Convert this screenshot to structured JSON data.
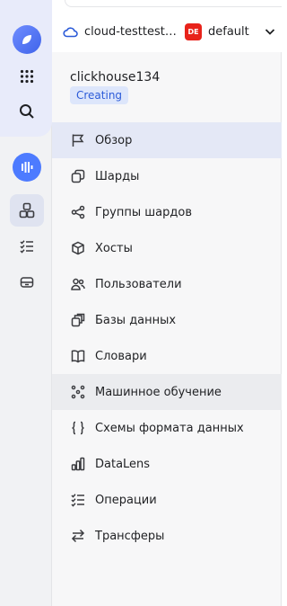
{
  "rail": {
    "logo_icon": "cloud-logo-icon",
    "items": [
      {
        "icon": "apps-grid-icon"
      },
      {
        "icon": "search-icon"
      },
      {
        "icon": "clickhouse-service-icon"
      },
      {
        "icon": "clusters-icon",
        "active": true
      },
      {
        "icon": "list-icon"
      },
      {
        "icon": "storage-icon"
      }
    ]
  },
  "header": {
    "folder": "cloud-testtestte…",
    "env_badge": "DE",
    "env_name": "default"
  },
  "cluster": {
    "name": "clickhouse134",
    "status": "Creating"
  },
  "menu": [
    {
      "label": "Обзор",
      "icon": "flag-icon",
      "state": "active"
    },
    {
      "label": "Шарды",
      "icon": "shards-icon"
    },
    {
      "label": "Группы шардов",
      "icon": "share-nodes-icon"
    },
    {
      "label": "Хосты",
      "icon": "cube-icon"
    },
    {
      "label": "Пользователи",
      "icon": "users-icon"
    },
    {
      "label": "Базы данных",
      "icon": "databases-icon"
    },
    {
      "label": "Словари",
      "icon": "book-icon"
    },
    {
      "label": "Машинное обучение",
      "icon": "ml-dots-icon",
      "state": "hover"
    },
    {
      "label": "Схемы формата данных",
      "icon": "braces-icon"
    },
    {
      "label": "DataLens",
      "icon": "bar-chart-icon"
    },
    {
      "label": "Операции",
      "icon": "operations-list-icon"
    },
    {
      "label": "Трансферы",
      "icon": "transfer-arrows-icon"
    }
  ],
  "colors": {
    "accent": "#4d7bff",
    "active_bg": "#e4e8f6",
    "status_bg": "#dde6fb",
    "status_text": "#2c5bd8",
    "env_badge": "#e8231b"
  }
}
